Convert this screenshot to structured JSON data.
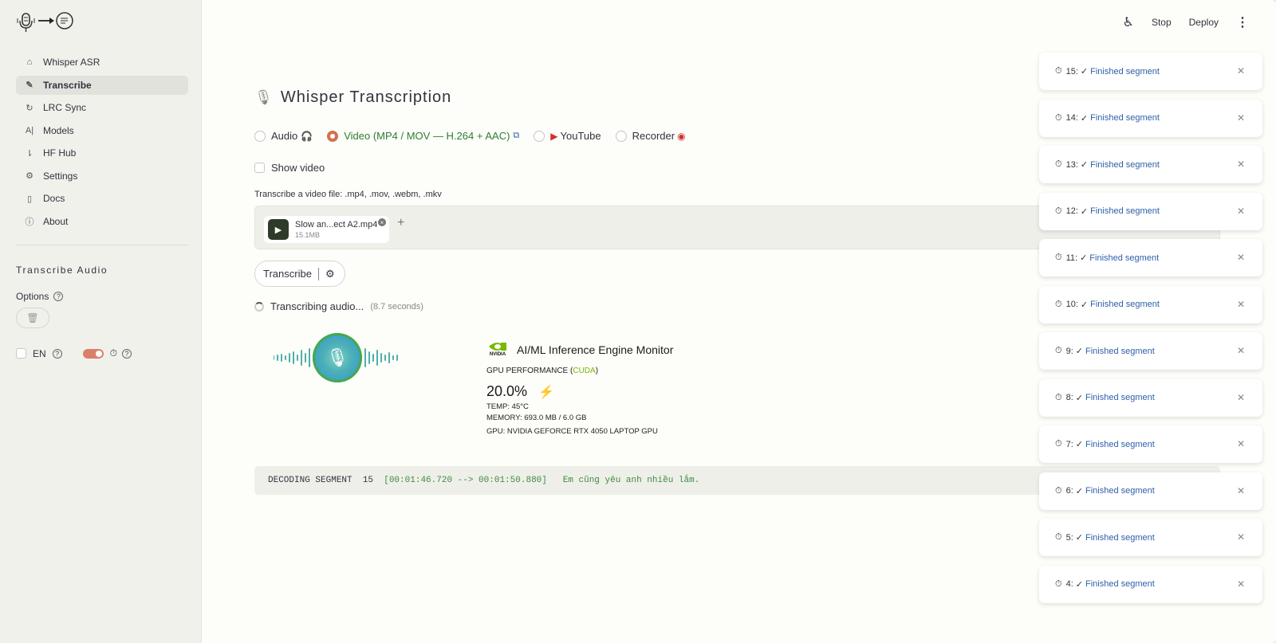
{
  "sidebar": {
    "items": [
      {
        "label": "Whisper ASR",
        "icon": "home-icon"
      },
      {
        "label": "Transcribe",
        "icon": "edit-icon"
      },
      {
        "label": "LRC Sync",
        "icon": "refresh-icon"
      },
      {
        "label": "Models",
        "icon": "ai-icon"
      },
      {
        "label": "HF Hub",
        "icon": "hub-icon"
      },
      {
        "label": "Settings",
        "icon": "gear-icon"
      },
      {
        "label": "Docs",
        "icon": "document-icon"
      },
      {
        "label": "About",
        "icon": "info-icon"
      }
    ],
    "active_index": 1,
    "section_heading": "Transcribe Audio",
    "options_label": "Options",
    "lang_label": "EN"
  },
  "topbar": {
    "stop_label": "Stop",
    "deploy_label": "Deploy"
  },
  "main": {
    "title": "Whisper Transcription",
    "radios": [
      {
        "label": "Audio",
        "selected": false
      },
      {
        "label": "Video (MP4 / MOV — H.264 + AAC)",
        "selected": true
      },
      {
        "label": "YouTube",
        "selected": false
      },
      {
        "label": "Recorder",
        "selected": false
      }
    ],
    "show_video_label": "Show video",
    "hint": "Transcribe a video file: .mp4, .mov, .webm, .mkv",
    "file": {
      "name": "Slow an...ect A2.mp4",
      "size": "15.1MB"
    },
    "transcribe_label": "Transcribe",
    "status_text": "Transcribing audio...",
    "elapsed_text": "(8.7 seconds)"
  },
  "gpu": {
    "logo_text": "NVIDIA",
    "title": "AI/ML Inference Engine Monitor",
    "perf_prefix": "GPU PERFORMANCE (",
    "perf_cuda": "CUDA",
    "perf_suffix": ")",
    "utilization": "20.0%",
    "temp": "TEMP: 45°C",
    "memory": "MEMORY: 693.0 MB / 6.0 GB",
    "gpu_name": "GPU: NVIDIA GEFORCE RTX 4050 LAPTOP GPU"
  },
  "log": {
    "label": "DECODING SEGMENT",
    "segment": "15",
    "timespan": "[00:01:46.720 --> 00:01:50.880]",
    "text": "Em cũng yêu anh nhiều lắm."
  },
  "toasts": [
    {
      "num": "15:",
      "check": "✓",
      "msg": "Finished segment"
    },
    {
      "num": "14:",
      "check": "✓",
      "msg": "Finished segment"
    },
    {
      "num": "13:",
      "check": "✓",
      "msg": "Finished segment"
    },
    {
      "num": "12:",
      "check": "✓",
      "msg": "Finished segment"
    },
    {
      "num": "11:",
      "check": "✓",
      "msg": "Finished segment"
    },
    {
      "num": "10:",
      "check": "✓",
      "msg": "Finished segment"
    },
    {
      "num": "9:",
      "check": "✓",
      "msg": "Finished segment"
    },
    {
      "num": "8:",
      "check": "✓",
      "msg": "Finished segment"
    },
    {
      "num": "7:",
      "check": "✓",
      "msg": "Finished segment"
    },
    {
      "num": "6:",
      "check": "✓",
      "msg": "Finished segment"
    },
    {
      "num": "5:",
      "check": "✓",
      "msg": "Finished segment"
    },
    {
      "num": "4:",
      "check": "✓",
      "msg": "Finished segment"
    }
  ],
  "colors": {
    "accent": "#d4704f",
    "success_text": "#3d8c3d",
    "toast_link": "#2e5faa",
    "nvidia_green": "#76b900"
  }
}
